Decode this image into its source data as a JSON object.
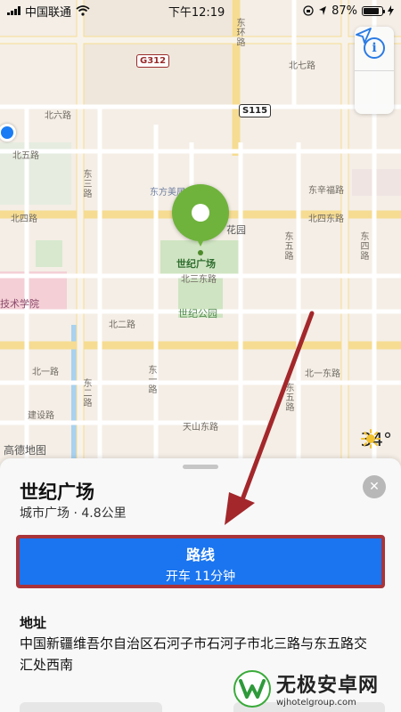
{
  "status_bar": {
    "carrier": "中国联通",
    "time": "下午12:19",
    "battery": "87%",
    "battery_level": 0.87
  },
  "map": {
    "badges": [
      "G312",
      "S115"
    ],
    "roads": [
      "北七路",
      "北六路",
      "北五路",
      "东辛福路",
      "北四路",
      "北四东路",
      "北三东路",
      "北二路",
      "北一路",
      "北一东路",
      "天山东路",
      "建设路",
      "东三路",
      "东二路",
      "东环路",
      "东五路",
      "东四路",
      "东一路"
    ],
    "pois": {
      "square": "世纪广场",
      "park": "世纪公园",
      "garden": "花园",
      "museum": "东方美居",
      "school": "技术学院",
      "logo": "高德地图"
    },
    "weather": {
      "temperature": "34°",
      "icon": "sun-icon"
    },
    "controls": [
      {
        "name": "info",
        "icon": "info-icon",
        "glyph": "i"
      },
      {
        "name": "location",
        "icon": "location-arrow-icon"
      }
    ]
  },
  "card": {
    "title": "世纪广场",
    "subtitle": "城市广场 · 4.8公里",
    "route_button": {
      "label": "路线",
      "detail": "开车 11分钟",
      "color": "#1b75f0",
      "highlight_color": "#a9343a"
    },
    "address_label": "地址",
    "address": "中国新疆维吾尔自治区石河子市石河子市北三路与东五路交汇处西南"
  },
  "watermark": {
    "name": "无极安卓网",
    "url": "wjhotelgroup.com"
  },
  "colors": {
    "accent": "#1b75f0",
    "pin": "#6fb33c",
    "annotation_arrow": "#a3272b"
  }
}
